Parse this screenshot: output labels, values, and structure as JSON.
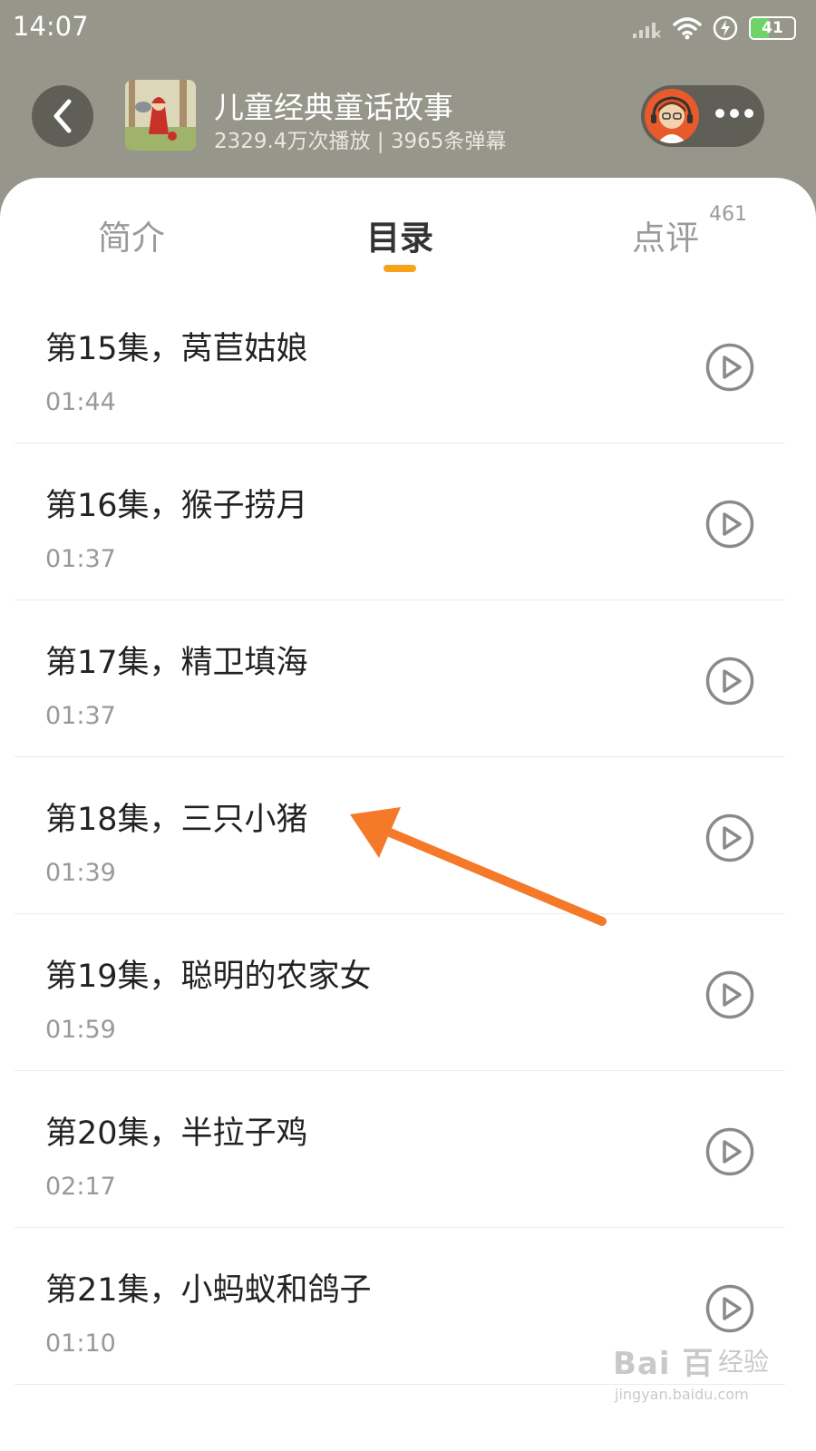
{
  "status_bar": {
    "time": "14:07",
    "battery": {
      "level": "41",
      "fraction": 0.41
    },
    "icons": [
      "signal-icon",
      "wifi-icon",
      "charging-icon",
      "battery-icon"
    ]
  },
  "header": {
    "album_title": "儿童经典童话故事",
    "album_stats": "2329.4万次播放 | 3965条弹幕"
  },
  "tabs": [
    {
      "label": "简介"
    },
    {
      "label": "目录",
      "active": true
    },
    {
      "label": "点评",
      "badge": "461"
    }
  ],
  "episodes": [
    {
      "title": "第15集，莴苣姑娘",
      "duration": "01:44"
    },
    {
      "title": "第16集，猴子捞月",
      "duration": "01:37"
    },
    {
      "title": "第17集，精卫填海",
      "duration": "01:37"
    },
    {
      "title": "第18集，三只小猪",
      "duration": "01:39"
    },
    {
      "title": "第19集，聪明的农家女",
      "duration": "01:59"
    },
    {
      "title": "第20集，半拉子鸡",
      "duration": "02:17"
    },
    {
      "title": "第21集，小蚂蚁和鸽子",
      "duration": "01:10"
    }
  ],
  "watermark": {
    "logo": "Bai 百",
    "text": "经验",
    "url": "jingyan.baidu.com"
  },
  "colors": {
    "header_bg": "#97968a",
    "accent": "#f6a417",
    "annotation_arrow": "#f47a2a",
    "play_icon": "#8a8a8a"
  }
}
